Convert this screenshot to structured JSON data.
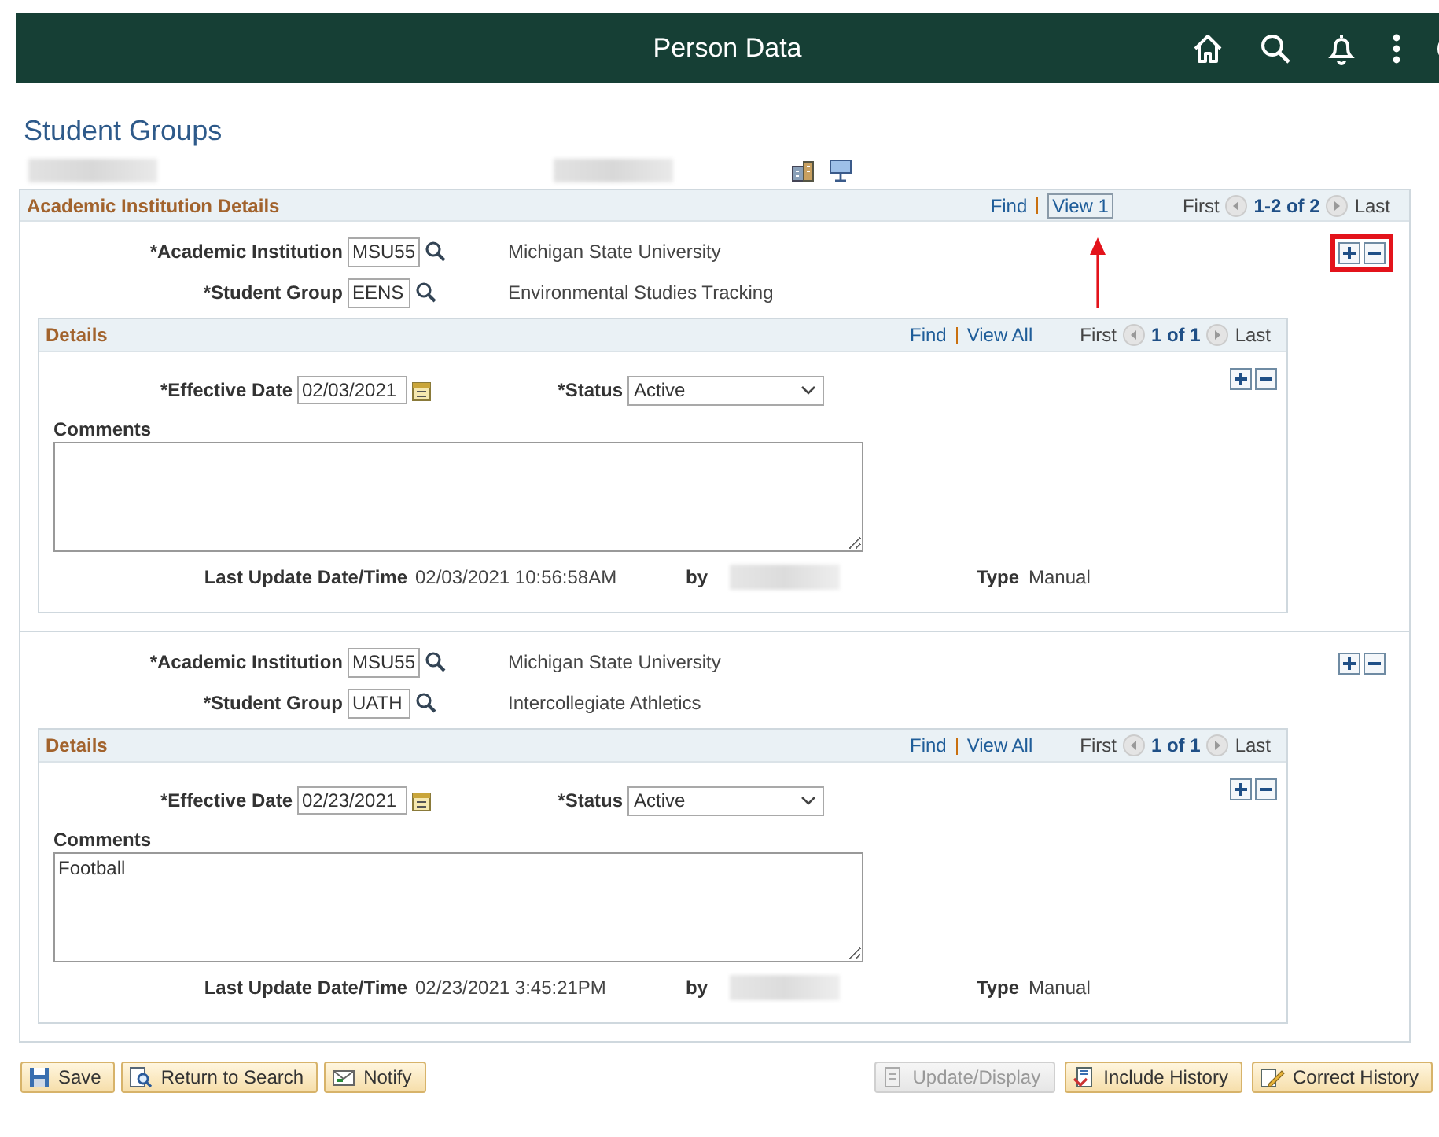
{
  "header": {
    "title": "Person Data"
  },
  "page_title": "Student Groups",
  "section": {
    "title": "Academic Institution Details",
    "find": "Find",
    "view": "View 1",
    "view_arrow": true,
    "first": "First",
    "range": "1-2 of 2",
    "last": "Last"
  },
  "records": [
    {
      "highlighted": true,
      "institution_label": "*Academic Institution",
      "institution_code": "MSU55",
      "institution_name": "Michigan State University",
      "group_label": "*Student Group",
      "group_code": "EENS",
      "group_name": "Environmental Studies Tracking",
      "details": {
        "title": "Details",
        "find": "Find",
        "view_all": "View All",
        "first": "First",
        "range": "1 of 1",
        "last": "Last",
        "effective_date_label": "*Effective Date",
        "effective_date": "02/03/2021",
        "status_label": "*Status",
        "status": "Active",
        "comments_label": "Comments",
        "last_update_label": "Last Update Date/Time",
        "last_update": "02/03/2021 10:56:58AM",
        "by_label": "by",
        "type_label": "Type",
        "type": "Manual"
      }
    },
    {
      "highlighted": false,
      "institution_label": "*Academic Institution",
      "institution_code": "MSU55",
      "institution_name": "Michigan State University",
      "group_label": "*Student Group",
      "group_code": "UATH",
      "group_name": "Intercollegiate Athletics",
      "details": {
        "title": "Details",
        "find": "Find",
        "view_all": "View All",
        "first": "First",
        "range": "1 of 1",
        "last": "Last",
        "effective_date_label": "*Effective Date",
        "effective_date": "02/23/2021",
        "status_label": "*Status",
        "status": "Active",
        "comments_label": "Comments",
        "comments": "Football",
        "last_update_label": "Last Update Date/Time",
        "last_update": "02/23/2021 3:45:21PM",
        "by_label": "by",
        "type_label": "Type",
        "type": "Manual"
      }
    }
  ],
  "buttons": [
    {
      "kind": "save",
      "label": "Save",
      "disabled": false
    },
    {
      "kind": "return",
      "label": "Return to Search",
      "disabled": false
    },
    {
      "kind": "notify",
      "label": "Notify",
      "disabled": false
    },
    {
      "kind": "update",
      "label": "Update/Display",
      "disabled": true
    },
    {
      "kind": "include",
      "label": "Include History",
      "disabled": false
    },
    {
      "kind": "correct",
      "label": "Correct History",
      "disabled": false
    }
  ]
}
